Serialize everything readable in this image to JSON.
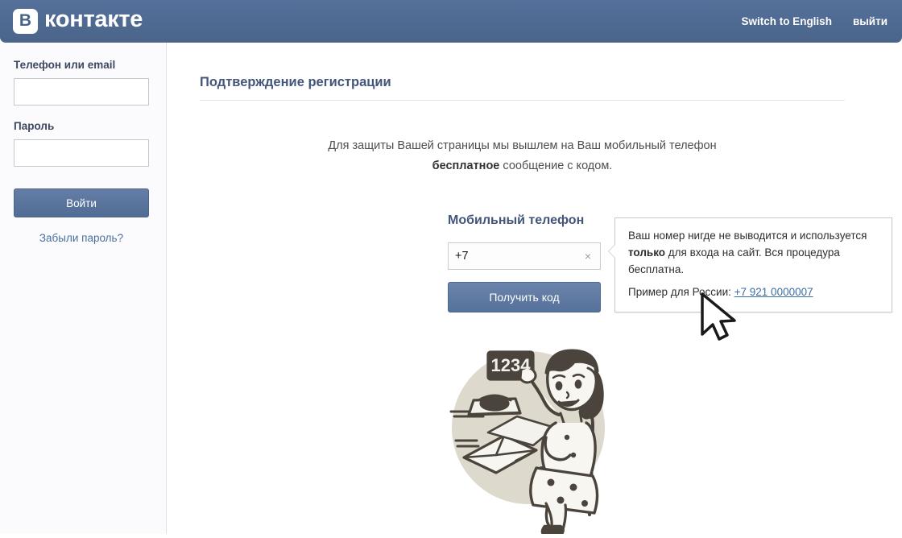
{
  "header": {
    "logo_mark": "В",
    "logo_text": "контакте",
    "switch_language": "Switch to English",
    "logout": "выйти"
  },
  "sidebar": {
    "login_label": "Телефон или email",
    "login_value": "",
    "login_placeholder": "",
    "password_label": "Пароль",
    "password_value": "",
    "password_placeholder": "",
    "signin_button": "Войти",
    "forgot_link": "Забыли пароль?"
  },
  "main": {
    "page_title": "Подтверждение регистрации",
    "intro_line1": "Для защиты Вашей страницы мы вышлем на Ваш мобильный телефон",
    "intro_bold": "бесплатное",
    "intro_line2_rest": " сообщение с кодом.",
    "phone_label": "Мобильный телефон",
    "phone_value": "+7",
    "phone_placeholder": "",
    "phone_clear_icon": "×",
    "get_code_button": "Получить код"
  },
  "tooltip": {
    "text_part1": "Ваш номер нигде не выводится и используется ",
    "text_bold": "только",
    "text_part2": " для входа на сайт. Вся процедура бесплатна.",
    "example_label": "Пример для России:",
    "example_link": "+7 921 0000007"
  },
  "illustration": {
    "sign_number": "1234",
    "alt": "woman-holding-code-sign-with-telephone-and-envelope"
  },
  "colors": {
    "header_blue": "#4a6489",
    "accent_blue": "#43557a",
    "link_blue": "#3b6ea5",
    "button_blue": "#56719a",
    "illustration_beige": "#ded9cd",
    "illustration_ink": "#4a443c"
  }
}
